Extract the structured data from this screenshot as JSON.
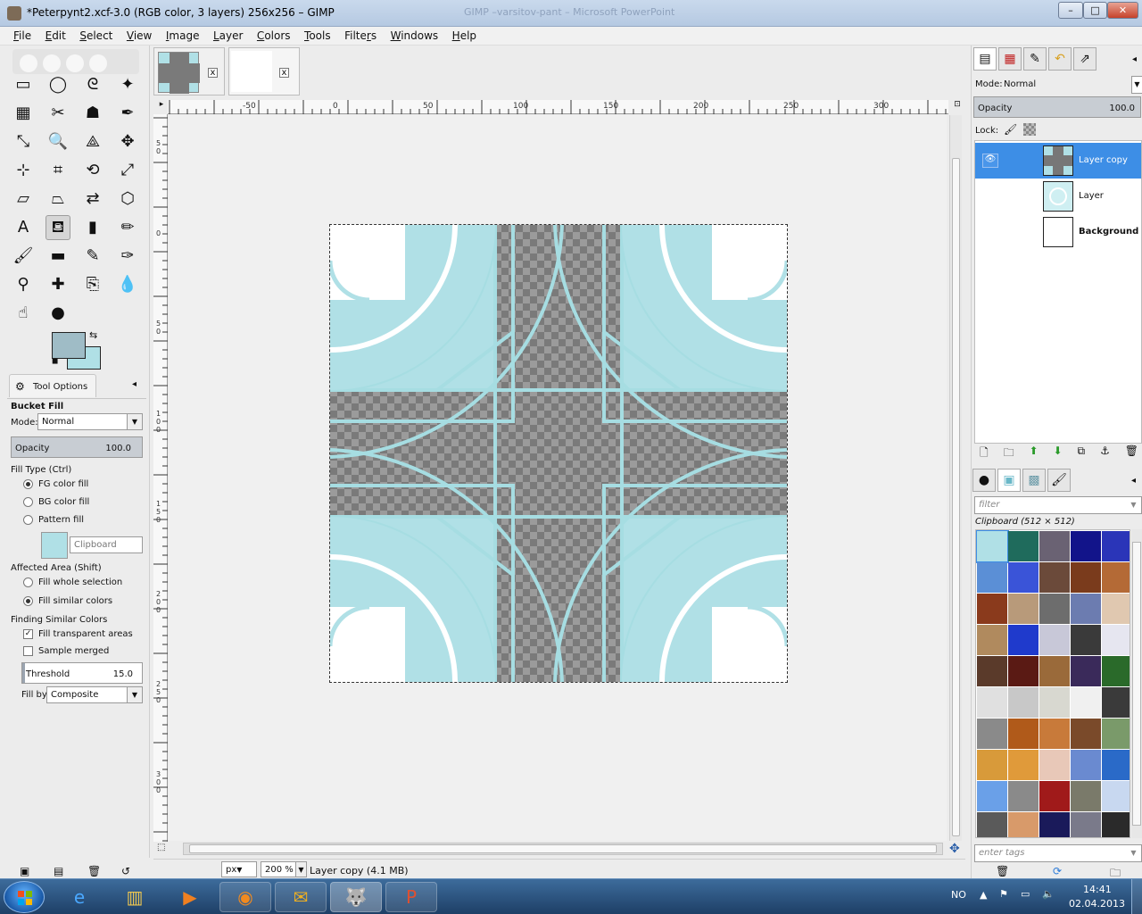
{
  "window": {
    "title": "*Peterpynt2.xcf-3.0 (RGB color, 3 layers) 256x256 – GIMP",
    "bg_title": "GIMP –varsitov-pant – Microsoft PowerPoint",
    "minimize": "–",
    "maximize": "□",
    "close": "✕"
  },
  "menu": [
    "File",
    "Edit",
    "Select",
    "View",
    "Image",
    "Layer",
    "Colors",
    "Tools",
    "Filters",
    "Windows",
    "Help"
  ],
  "menu_mnemonic": [
    "F",
    "E",
    "S",
    "V",
    "I",
    "L",
    "C",
    "T",
    "r",
    "W",
    "H"
  ],
  "tools": [
    {
      "name": "rect-select-icon",
      "glyph": "▭"
    },
    {
      "name": "ellipse-select-icon",
      "glyph": "◯"
    },
    {
      "name": "free-select-icon",
      "glyph": "ᘓ"
    },
    {
      "name": "fuzzy-select-icon",
      "glyph": "✦"
    },
    {
      "name": "select-by-color-icon",
      "glyph": "▦"
    },
    {
      "name": "scissors-icon",
      "glyph": "✂"
    },
    {
      "name": "foreground-select-icon",
      "glyph": "☗"
    },
    {
      "name": "paths-icon",
      "glyph": "✒"
    },
    {
      "name": "color-picker-icon",
      "glyph": "⤡"
    },
    {
      "name": "zoom-icon",
      "glyph": "🔍"
    },
    {
      "name": "measure-icon",
      "glyph": "⟁"
    },
    {
      "name": "move-icon",
      "glyph": "✥"
    },
    {
      "name": "align-icon",
      "glyph": "⊹"
    },
    {
      "name": "crop-icon",
      "glyph": "⌗"
    },
    {
      "name": "rotate-icon",
      "glyph": "⟲"
    },
    {
      "name": "scale-icon",
      "glyph": "⤢"
    },
    {
      "name": "shear-icon",
      "glyph": "▱"
    },
    {
      "name": "perspective-icon",
      "glyph": "⏢"
    },
    {
      "name": "flip-icon",
      "glyph": "⇄"
    },
    {
      "name": "cage-icon",
      "glyph": "⬡"
    },
    {
      "name": "text-icon",
      "glyph": "A"
    },
    {
      "name": "bucket-fill-icon",
      "glyph": "⛾",
      "active": true
    },
    {
      "name": "blend-icon",
      "glyph": "▮"
    },
    {
      "name": "pencil-icon",
      "glyph": "✏"
    },
    {
      "name": "paintbrush-icon",
      "glyph": "🖌"
    },
    {
      "name": "eraser-icon",
      "glyph": "▬"
    },
    {
      "name": "airbrush-icon",
      "glyph": "✎"
    },
    {
      "name": "ink-icon",
      "glyph": "✑"
    },
    {
      "name": "clone-icon",
      "glyph": "⚲"
    },
    {
      "name": "heal-icon",
      "glyph": "✚"
    },
    {
      "name": "perspective-clone-icon",
      "glyph": "⎘"
    },
    {
      "name": "blur-icon",
      "glyph": "💧"
    },
    {
      "name": "smudge-icon",
      "glyph": "☝"
    },
    {
      "name": "dodge-burn-icon",
      "glyph": "●"
    }
  ],
  "colors": {
    "fg": "#9fbcc6",
    "bg": "#b0e0e6",
    "accent": "#3d8ee6"
  },
  "tool_options": {
    "tab": "Tool Options",
    "title": "Bucket Fill",
    "mode_label": "Mode:",
    "mode_value": "Normal",
    "opacity_label": "Opacity",
    "opacity_value": "100.0",
    "fill_type_label": "Fill Type  (Ctrl)",
    "fill_fg": "FG color fill",
    "fill_bg": "BG color fill",
    "fill_pattern": "Pattern fill",
    "pattern_name": "Clipboard",
    "affected_label": "Affected Area  (Shift)",
    "fill_whole": "Fill whole selection",
    "fill_similar": "Fill similar colors",
    "finding_label": "Finding Similar Colors",
    "fill_transparent": "Fill transparent areas",
    "sample_merged": "Sample merged",
    "threshold_label": "Threshold",
    "threshold_value": "15.0",
    "fillby_label": "Fill by:",
    "fillby_value": "Composite"
  },
  "ruler_h": [
    "-50",
    "0",
    "50",
    "100",
    "150",
    "200",
    "250",
    "300"
  ],
  "ruler_v": [
    "50",
    "0",
    "50",
    "100",
    "150",
    "200",
    "250",
    "300"
  ],
  "status": {
    "unit": "px",
    "zoom": "200 %",
    "info": "Layer copy (4.1 MB)"
  },
  "layers": {
    "mode_label": "Mode:",
    "mode_value": "Normal",
    "opacity_label": "Opacity",
    "opacity_value": "100.0",
    "lock_label": "Lock:",
    "items": [
      {
        "name": "Layer copy",
        "visible": true,
        "selected": true
      },
      {
        "name": "Layer",
        "visible": false,
        "selected": false
      },
      {
        "name": "Background",
        "visible": false,
        "selected": false
      }
    ]
  },
  "patterns": {
    "filter_placeholder": "filter",
    "selected_title": "Clipboard (512 × 512)",
    "tags_placeholder": "enter tags",
    "swatches": [
      "#b0e0e6",
      "#1f6b5c",
      "#6a6273",
      "#12148a",
      "#2a35b8",
      "#5b8fd6",
      "#3a54d8",
      "#6b4a3a",
      "#7a3b1c",
      "#b46a36",
      "#8a3a1c",
      "#b89a7a",
      "#6d6d6d",
      "#6c7cb0",
      "#e0c8b0",
      "#b08a5e",
      "#1f3acc",
      "#c8c8d8",
      "#3a3a3a",
      "#e6e6f0",
      "#5a3a2a",
      "#5a1a14",
      "#9a6a3a",
      "#3a2a5a",
      "#2a6a2a",
      "#e0e0e0",
      "#c8c8c8",
      "#d8d8d0",
      "#f0f0f0",
      "#3a3a3a",
      "#8a8a8a",
      "#b05a1a",
      "#c87a3a",
      "#7a4a2a",
      "#7a9a6a",
      "#d89a3a",
      "#e09a3a",
      "#e8c8b8",
      "#6a8ad0",
      "#2a6ac8",
      "#6aa0e8",
      "#8a8a8a",
      "#a01a1a",
      "#7a7a6a",
      "#c8d8f0",
      "#5a5a5a",
      "#d89a6a",
      "#1a1a5a",
      "#7a7a8a",
      "#2a2a2a"
    ]
  },
  "taskbar": {
    "lang": "NO",
    "time": "14:41",
    "date": "02.04.2013"
  }
}
